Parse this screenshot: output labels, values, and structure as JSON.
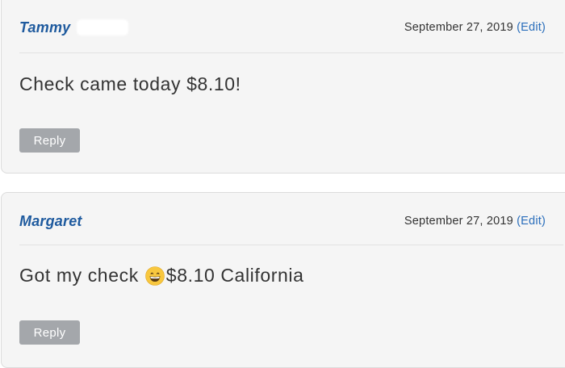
{
  "comments": [
    {
      "author": "Tammy",
      "date": "September 27, 2019",
      "edit_label": "(Edit)",
      "body": "Check came today $8.10!",
      "reply_label": "Reply"
    },
    {
      "author": "Margaret",
      "date": "September 27, 2019",
      "edit_label": "(Edit)",
      "body_before_emoji": "Got my check",
      "emoji": "grinning-face-emoji",
      "body_after_emoji": "$8.10 California",
      "reply_label": "Reply"
    }
  ],
  "colors": {
    "author": "#1e5a9e",
    "edit_link": "#2a6ebb",
    "card_background": "#f5f5f5",
    "reply_button": "#a4a7ab"
  }
}
